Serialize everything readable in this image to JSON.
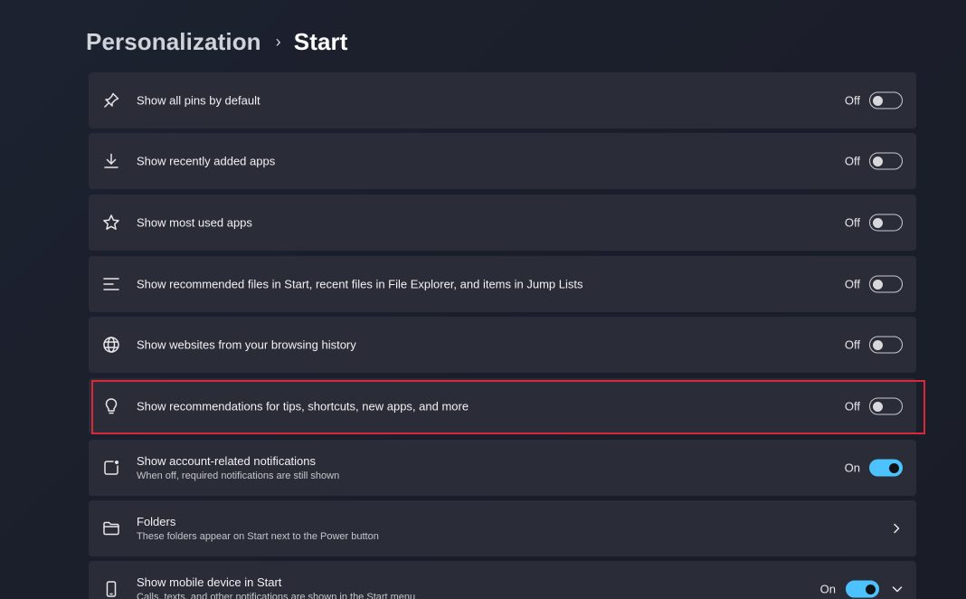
{
  "breadcrumb": {
    "parent": "Personalization",
    "separator": "›",
    "current": "Start"
  },
  "settings": [
    {
      "icon": "pin-icon",
      "title": "Show all pins by default",
      "state": "Off",
      "on": false
    },
    {
      "icon": "download-icon",
      "title": "Show recently added apps",
      "state": "Off",
      "on": false
    },
    {
      "icon": "star-icon",
      "title": "Show most used apps",
      "state": "Off",
      "on": false
    },
    {
      "icon": "list-icon",
      "title": "Show recommended files in Start, recent files in File Explorer, and items in Jump Lists",
      "state": "Off",
      "on": false
    },
    {
      "icon": "globe-icon",
      "title": "Show websites from your browsing history",
      "state": "Off",
      "on": false
    },
    {
      "icon": "lightbulb-icon",
      "title": "Show recommendations for tips, shortcuts, new apps, and more",
      "state": "Off",
      "on": false,
      "highlighted": true
    },
    {
      "icon": "notification-icon",
      "title": "Show account-related notifications",
      "subtitle": "When off, required notifications are still shown",
      "state": "On",
      "on": true
    },
    {
      "icon": "folder-icon",
      "title": "Folders",
      "subtitle": "These folders appear on Start next to the Power button",
      "chevron": "right"
    },
    {
      "icon": "phone-icon",
      "title": "Show mobile device in Start",
      "subtitle": "Calls, texts, and other notifications are shown in the Start menu",
      "state": "On",
      "on": true,
      "chevron": "down"
    }
  ],
  "colors": {
    "accent": "#4cc2ff",
    "highlight": "#d9283a",
    "card": "#2a2d38"
  }
}
